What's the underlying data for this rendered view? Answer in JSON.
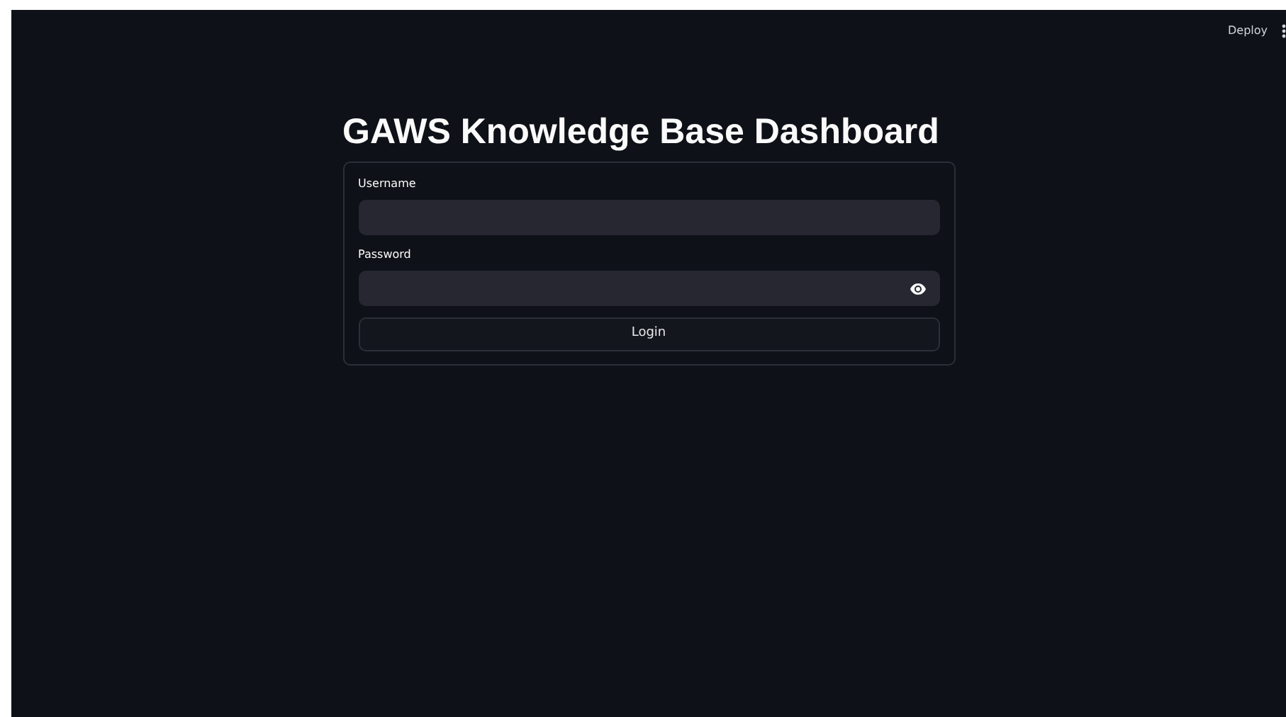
{
  "toolbar": {
    "deploy": "Deploy"
  },
  "title": "GAWS Knowledge Base Dashboard",
  "form": {
    "fields": [
      {
        "label": "Username",
        "kind": "text"
      },
      {
        "label": "Password",
        "kind": "password"
      }
    ],
    "button": "Login"
  }
}
